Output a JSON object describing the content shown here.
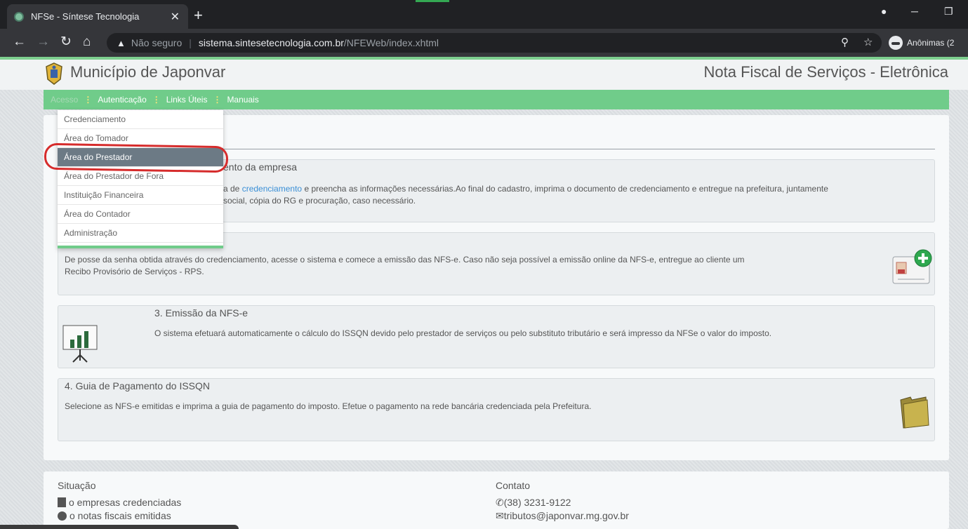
{
  "browser": {
    "tab_title": "NFSe - Síntese Tecnologia",
    "security_label": "Não seguro",
    "url_host": "sistema.sintesetecnologia.com.br",
    "url_path": "/NFEWeb/index.xhtml",
    "profile_label": "Anônimas (2"
  },
  "header": {
    "municipality": "Município de Japonvar",
    "system_title": "Nota Fiscal de Serviços - Eletrônica"
  },
  "menu": {
    "items": [
      "Acesso",
      "Autenticação",
      "Links Úteis",
      "Manuais"
    ],
    "separator": "⋮"
  },
  "dropdown": {
    "options": [
      "Credenciamento",
      "Área do Tomador",
      "Área do Prestador",
      "Área do Prestador de Fora",
      "Instituição Financeira",
      "Área do Contador",
      "Administração"
    ]
  },
  "steps": {
    "step1": {
      "title_visible": "ento da empresa",
      "line1_pre": "a de",
      "line1_link": "credenciamento",
      "line1_post": " e preencha as informações necessárias.Ao final do cadastro, imprima o documento de credenciamento e entregue na prefeitura, juntamente",
      "line2": "social, cópia do RG e procuração, caso necessário."
    },
    "step2": {
      "line1": "De posse da senha obtida através do credenciamento, acesse o sistema e comece a emissão das NFS-e. Caso não seja possível a emissão online da NFS-e, entregue ao cliente um",
      "line2": "Recibo Provisório de Serviços - RPS."
    },
    "step3": {
      "title": "3. Emissão da NFS-e",
      "text": "O sistema efetuará automaticamente o cálculo do ISSQN devido pelo prestador de serviços ou pelo substituto tributário e será impresso da NFSe o valor do imposto."
    },
    "step4": {
      "title": "4. Guia de Pagamento do ISSQN",
      "text": "Selecione as NFS-e emitidas e imprima a guia de pagamento do imposto. Efetue o pagamento na rede bancária credenciada pela Prefeitura."
    }
  },
  "footer": {
    "situacao_title": "Situação",
    "empresas": "o empresas credenciadas",
    "notas": "o notas fiscais emitidas",
    "contato_title": "Contato",
    "phone": "(38) 3231-9122",
    "email": "tributos@japonvar.mg.gov.br"
  }
}
